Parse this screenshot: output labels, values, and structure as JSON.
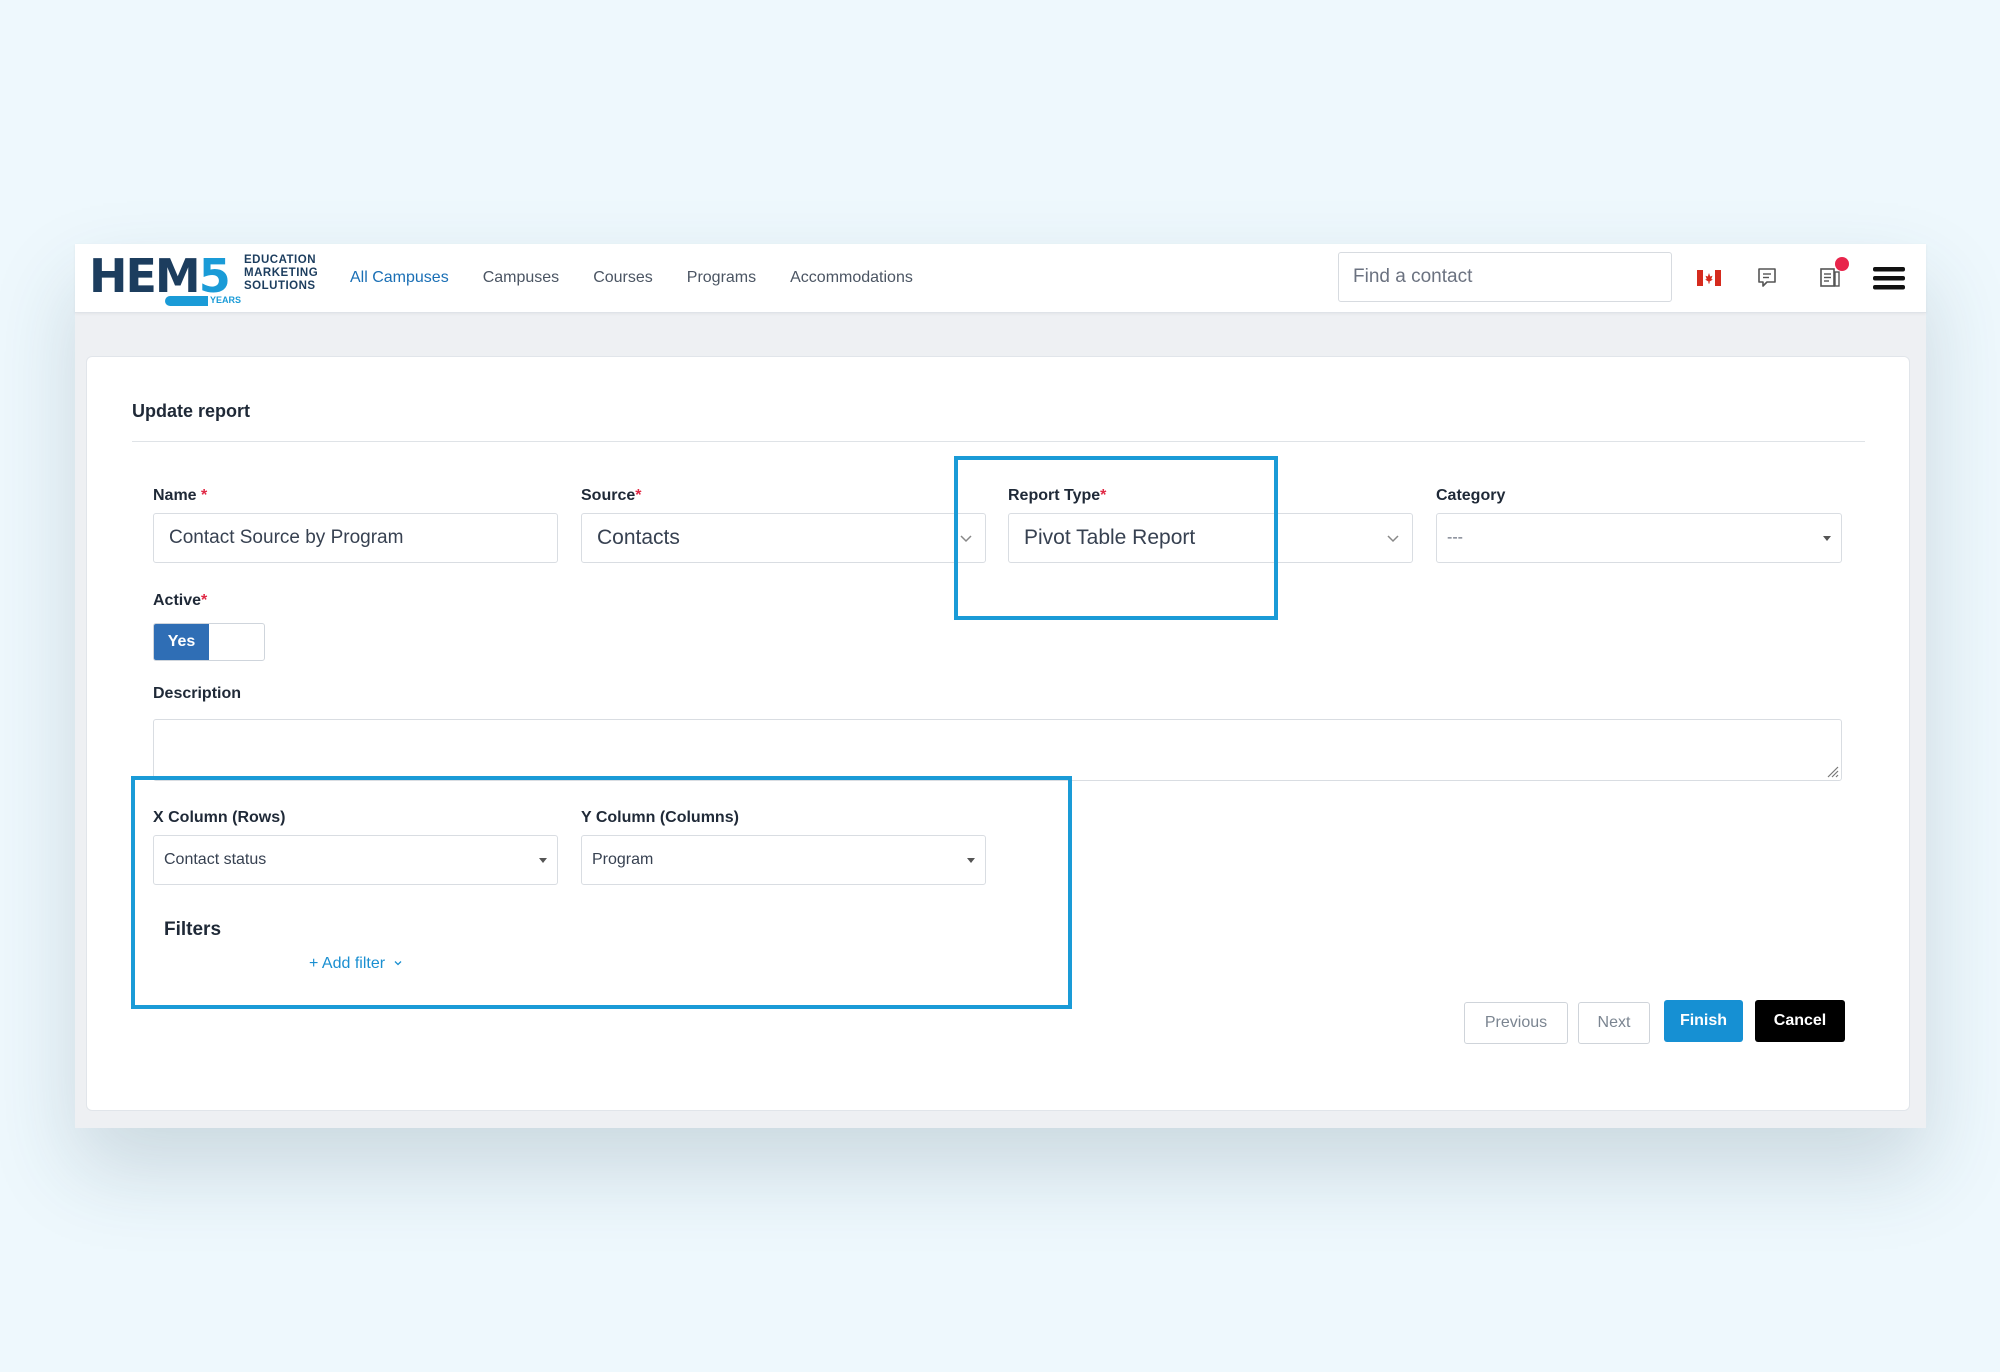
{
  "header": {
    "logo": {
      "brand": "HEM",
      "number": "5",
      "tagline": [
        "EDUCATION",
        "MARKETING",
        "SOLUTIONS"
      ],
      "years": "YEARS"
    },
    "nav": [
      {
        "label": "All Campuses",
        "active": true
      },
      {
        "label": "Campuses",
        "active": false
      },
      {
        "label": "Courses",
        "active": false
      },
      {
        "label": "Programs",
        "active": false
      },
      {
        "label": "Accommodations",
        "active": false
      }
    ],
    "search": {
      "placeholder": "Find a contact",
      "value": ""
    },
    "icons": [
      "canada-flag-icon",
      "chat-icon",
      "document-icon",
      "menu-icon"
    ],
    "notification_color": "#e8254b"
  },
  "form": {
    "title": "Update report",
    "name": {
      "label": "Name",
      "required": "*",
      "value": "Contact Source by Program"
    },
    "source": {
      "label": "Source",
      "required": "*",
      "value": "Contacts"
    },
    "report_type": {
      "label": "Report Type",
      "required": "*",
      "value": "Pivot Table Report"
    },
    "category": {
      "label": "Category",
      "value": "---"
    },
    "active": {
      "label": "Active",
      "required": "*",
      "value": "Yes"
    },
    "description": {
      "label": "Description",
      "value": ""
    },
    "x_column": {
      "label": "X Column (Rows)",
      "value": "Contact status"
    },
    "y_column": {
      "label": "Y Column (Columns)",
      "value": "Program"
    },
    "filters": {
      "title": "Filters",
      "add_label": "+ Add filter"
    }
  },
  "actions": {
    "previous": "Previous",
    "next": "Next",
    "finish": "Finish",
    "cancel": "Cancel"
  },
  "colors": {
    "accent": "#1a9bd7",
    "primary_button": "#1690d3",
    "toggle_on": "#2f6eb5",
    "required": "#e02945"
  }
}
